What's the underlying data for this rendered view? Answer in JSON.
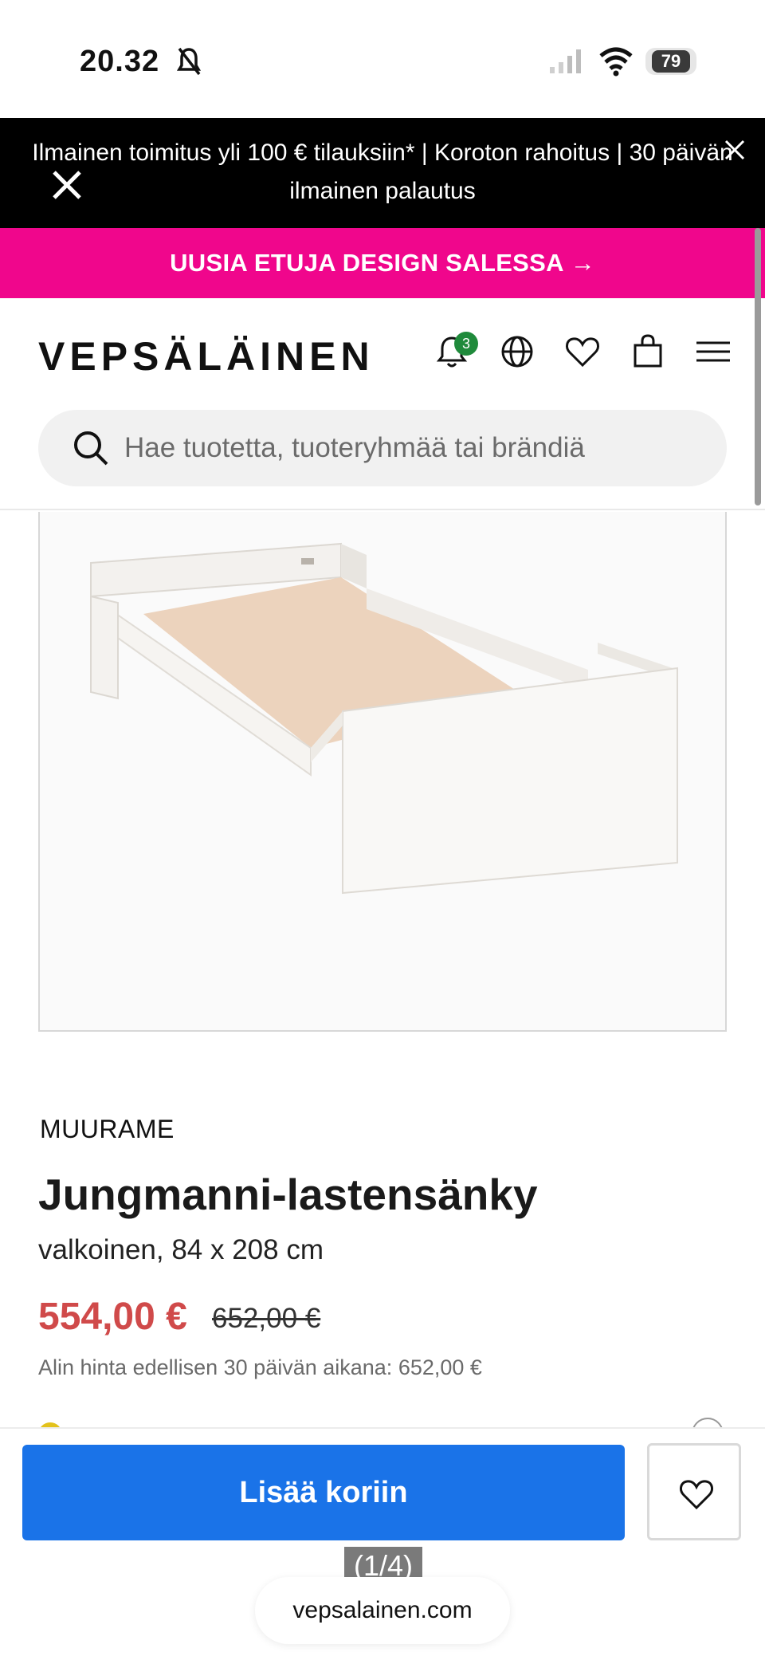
{
  "status_bar": {
    "time": "20.32",
    "battery": "79"
  },
  "promo_banner": {
    "text": "Ilmainen toimitus yli 100 € tilauksiin* | Koroton rahoitus | 30 päivän ilmainen palautus"
  },
  "pink_banner": {
    "text": "UUSIA ETUJA DESIGN SALESSA →"
  },
  "header": {
    "logo": "VEPSÄLÄINEN",
    "notification_count": "3",
    "search_placeholder": "Hae tuotetta, tuoteryhmää tai brändiä"
  },
  "product": {
    "brand": "MUURAME",
    "title": "Jungmanni-lastensänky",
    "variant": "valkoinen, 84 x 208 cm",
    "price": "554,00 €",
    "old_price": "652,00 €",
    "lowest_price_note": "Alin hinta edellisen 30 päivän aikana: 652,00 €"
  },
  "actions": {
    "add_to_cart": "Lisää koriin"
  },
  "overlay": {
    "image_counter": "(1/4)",
    "url": "vepsalainen.com"
  },
  "colors": {
    "promo_bg": "#000000",
    "pink_banner": "#f0068c",
    "price_sale": "#d04a4a",
    "primary_button": "#1a73e8",
    "badge": "#1f8a3b"
  }
}
